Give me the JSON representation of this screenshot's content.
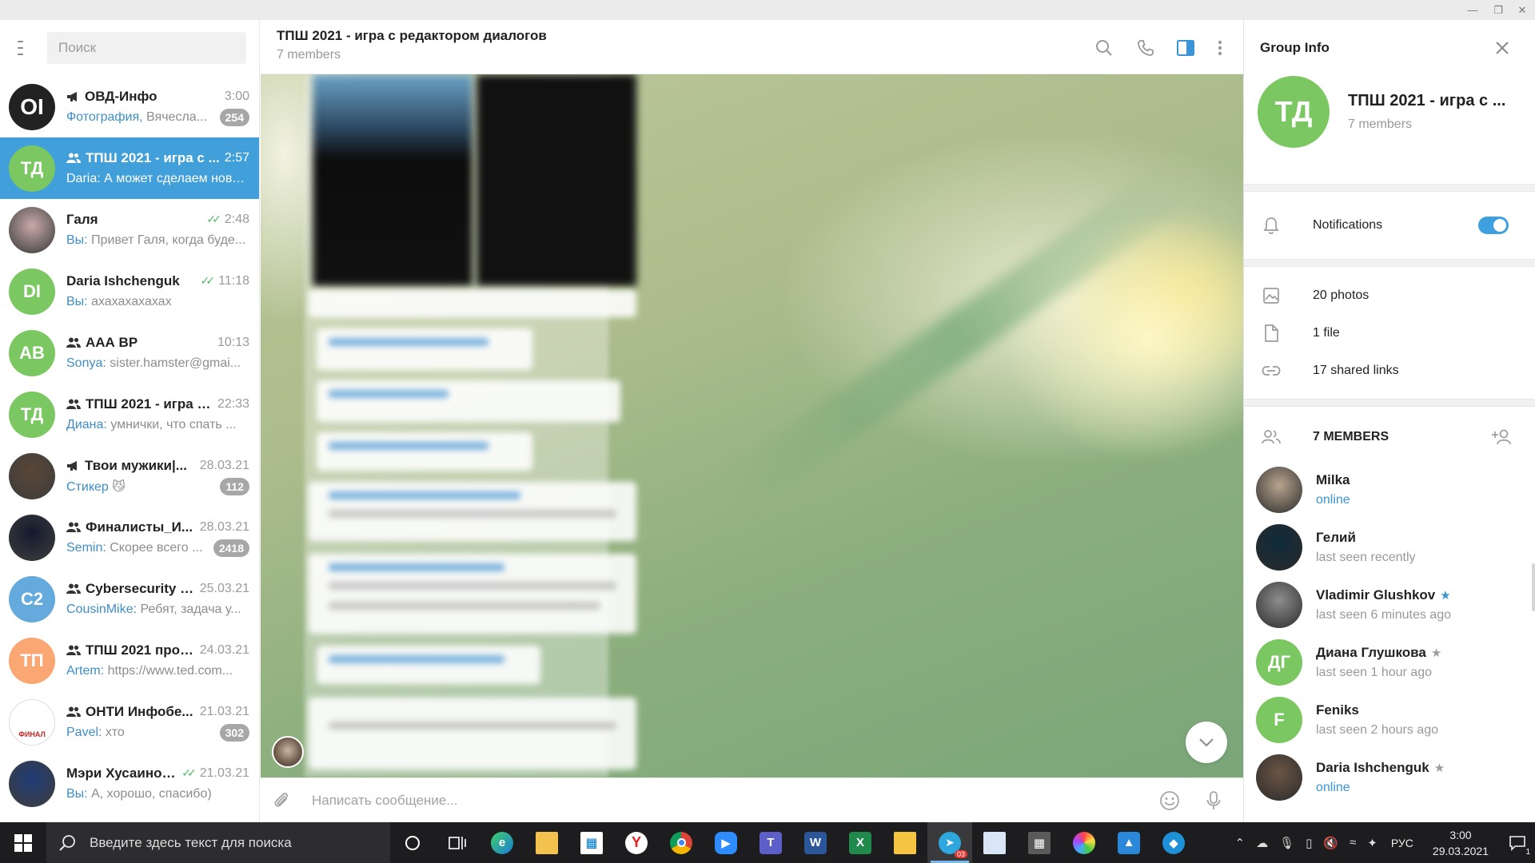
{
  "window": {
    "controls": [
      "minimize",
      "restore",
      "close"
    ]
  },
  "sidebar": {
    "search_placeholder": "Поиск",
    "chats": [
      {
        "title": "ОВД-Инфо",
        "type": "channel",
        "time": "3:00",
        "sender": "Фотография,",
        "preview": " Вячесла...",
        "badge": "254",
        "avatar_text": "OI",
        "avatar_color": "#222222",
        "active": false
      },
      {
        "title": "ТПШ 2021 - игра с ...",
        "type": "group",
        "time": "2:57",
        "sender": "Daria:",
        "preview": " А может сделаем нове...",
        "badge": "",
        "avatar_text": "ТД",
        "avatar_color": "#7bc862",
        "active": true
      },
      {
        "title": "Галя",
        "type": "user",
        "time": "2:48",
        "read": true,
        "sender": "Вы:",
        "preview": " Привет Галя, когда буде...",
        "badge": "",
        "avatar_text": "",
        "avatar_color": "#c9a9a9",
        "active": false
      },
      {
        "title": "Daria Ishchenguk",
        "type": "user",
        "time": "11:18",
        "read": true,
        "sender": "Вы:",
        "preview": " ахахахахахах",
        "badge": "",
        "avatar_text": "DI",
        "avatar_color": "#7bc862",
        "active": false
      },
      {
        "title": "ААА ВР",
        "type": "group",
        "time": "10:13",
        "sender": "Sonya:",
        "preview": " sister.hamster@gmai...",
        "badge": "",
        "avatar_text": "АВ",
        "avatar_color": "#7bc862",
        "active": false
      },
      {
        "title": "ТПШ 2021 - игра с ...",
        "type": "group",
        "time": "22:33",
        "sender": "Диана:",
        "preview": " умнички, что спать ...",
        "badge": "",
        "avatar_text": "ТД",
        "avatar_color": "#7bc862",
        "active": false
      },
      {
        "title": "Твои мужики|...",
        "type": "channel",
        "time": "28.03.21",
        "sender": "Стикер",
        "preview": " 😼",
        "badge": "112",
        "avatar_text": "",
        "avatar_color": "#5a4636",
        "active": false
      },
      {
        "title": "Финалисты_И...",
        "type": "group",
        "time": "28.03.21",
        "sender": "Semin:",
        "preview": " Скорее всего ...",
        "badge": "2418",
        "avatar_text": "",
        "avatar_color": "#141a2e",
        "active": false
      },
      {
        "title": "Cybersecurity #2",
        "type": "group",
        "time": "25.03.21",
        "sender": "CousinMike:",
        "preview": " Ребят, задача у...",
        "badge": "",
        "avatar_text": "C2",
        "avatar_color": "#65aadd",
        "active": false
      },
      {
        "title": "ТПШ 2021 прог...",
        "type": "group",
        "time": "24.03.21",
        "sender": "Artem:",
        "preview": " https://www.ted.com...",
        "badge": "",
        "avatar_text": "ТП",
        "avatar_color": "#faa774",
        "active": false
      },
      {
        "title": "ОНТИ Инфобе...",
        "type": "group",
        "time": "21.03.21",
        "sender": "Pavel:",
        "preview": " хто",
        "badge": "302",
        "avatar_text": "ФИНАЛ",
        "avatar_color": "#ffffff",
        "active": false
      },
      {
        "title": "Мэри Хусаинова",
        "type": "user",
        "time": "21.03.21",
        "read": true,
        "sender": "Вы:",
        "preview": " А, хорошо, спасибо)",
        "badge": "",
        "avatar_text": "",
        "avatar_color": "#1f3c78",
        "active": false
      }
    ]
  },
  "header": {
    "title": "ТПШ 2021 - игра с редактором диалогов",
    "subtitle": "7 members",
    "icons": [
      "search-icon",
      "phone-icon",
      "sidebar-toggle-icon",
      "more-icon"
    ]
  },
  "composer": {
    "placeholder": "Написать сообщение...",
    "icons": [
      "attach-icon",
      "emoji-icon",
      "microphone-icon"
    ]
  },
  "info": {
    "title": "Group Info",
    "group_title": "ТПШ 2021 - игра с ...",
    "group_sub": "7 members",
    "avatar_text": "ТД",
    "notifications_label": "Notifications",
    "notifications_on": true,
    "media": [
      {
        "label": "20 photos",
        "icon": "photo-icon"
      },
      {
        "label": "1 file",
        "icon": "file-icon"
      },
      {
        "label": "17 shared links",
        "icon": "link-icon"
      }
    ],
    "members_label": "7 MEMBERS",
    "members": [
      {
        "name": "Milka",
        "status": "online",
        "online": true,
        "star": false,
        "avatar_text": "",
        "avatar_color": "#b7a48e"
      },
      {
        "name": "Гелий",
        "status": "last seen recently",
        "online": false,
        "star": false,
        "avatar_text": "",
        "avatar_color": "#0e2a3a"
      },
      {
        "name": "Vladimir Glushkov",
        "status": "last seen 6 minutes ago",
        "online": false,
        "star": true,
        "star_color": "#3a94d6",
        "avatar_text": "",
        "avatar_color": "#8d8d8d"
      },
      {
        "name": "Диана Глушкова",
        "status": "last seen 1 hour ago",
        "online": false,
        "star": true,
        "star_color": "#9c9c9c",
        "avatar_text": "ДГ",
        "avatar_color": "#7bc862"
      },
      {
        "name": "Feniks",
        "status": "last seen 2 hours ago",
        "online": false,
        "star": false,
        "avatar_text": "F",
        "avatar_color": "#7bc862"
      },
      {
        "name": "Daria Ishchenguk",
        "status": "online",
        "online": true,
        "star": true,
        "star_color": "#9c9c9c",
        "avatar_text": "",
        "avatar_color": "#6b5544"
      }
    ]
  },
  "taskbar": {
    "search_placeholder": "Введите здесь текст для поиска",
    "apps": [
      "cortana",
      "task-view",
      "edge",
      "explorer",
      "store",
      "yandex",
      "chrome",
      "zoom",
      "teams",
      "word",
      "excel",
      "folder",
      "telegram",
      "notes",
      "calculator",
      "paint",
      "photos",
      "shield"
    ],
    "telegram_badge": "03",
    "lang": "РУС",
    "time": "3:00",
    "date": "29.03.2021",
    "notification_count": "1"
  }
}
